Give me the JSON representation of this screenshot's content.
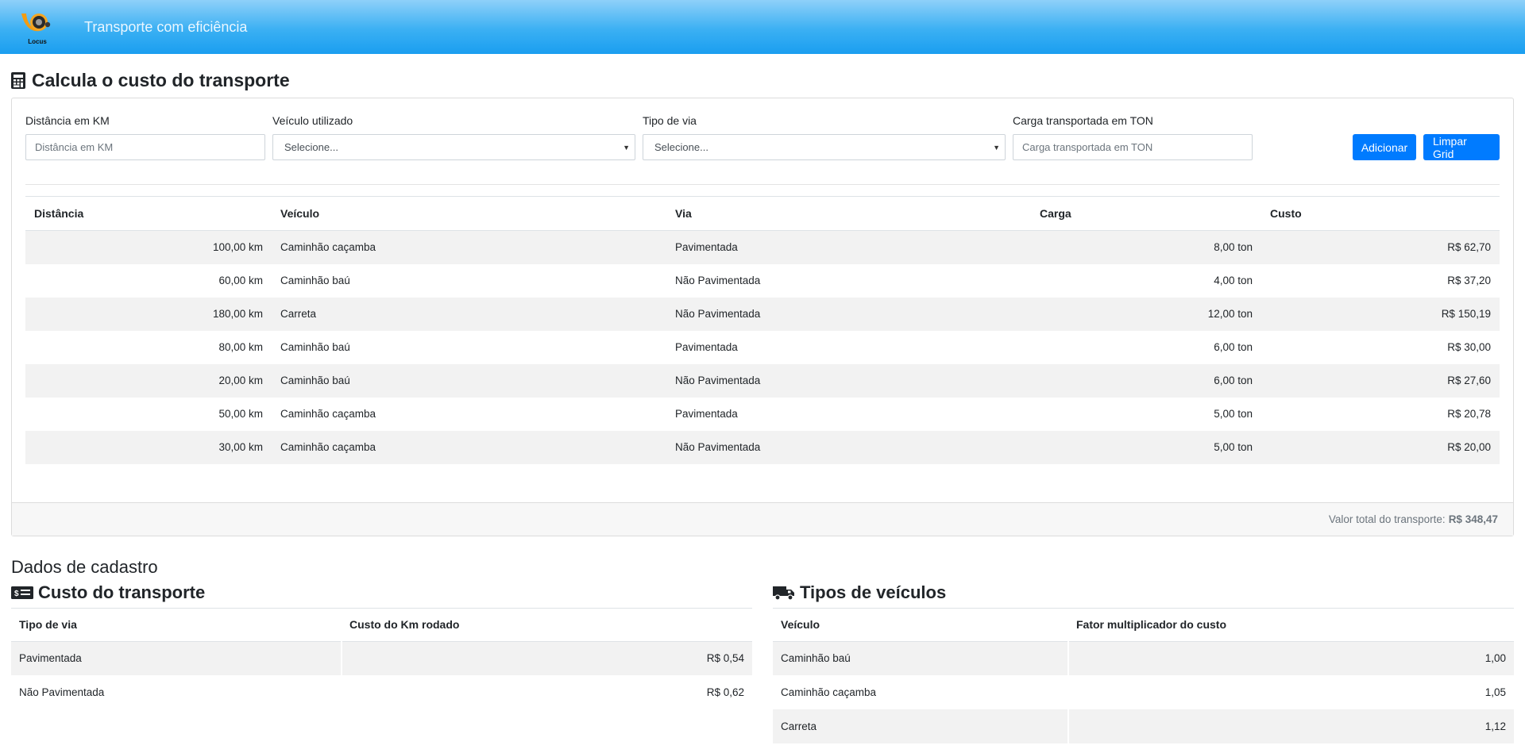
{
  "header": {
    "brand": "Transporte com eficiência",
    "logo_text": "Locus"
  },
  "calc": {
    "title": "Calcula o custo do transporte",
    "distance": {
      "label": "Distância em KM",
      "placeholder": "Distância em KM"
    },
    "vehicle": {
      "label": "Veículo utilizado",
      "selected": "Selecione..."
    },
    "road": {
      "label": "Tipo de via",
      "selected": "Selecione..."
    },
    "load": {
      "label": "Carga transportada em TON",
      "placeholder": "Carga transportada em TON"
    },
    "add_label": "Adicionar",
    "clear_label": "Limpar Grid",
    "columns": [
      "Distância",
      "Veículo",
      "Via",
      "Carga",
      "Custo"
    ],
    "rows": [
      {
        "distance": "100,00 km",
        "vehicle": "Caminhão caçamba",
        "road": "Pavimentada",
        "load": "8,00 ton",
        "cost": "R$ 62,70"
      },
      {
        "distance": "60,00 km",
        "vehicle": "Caminhão baú",
        "road": "Não Pavimentada",
        "load": "4,00 ton",
        "cost": "R$ 37,20"
      },
      {
        "distance": "180,00 km",
        "vehicle": "Carreta",
        "road": "Não Pavimentada",
        "load": "12,00 ton",
        "cost": "R$ 150,19"
      },
      {
        "distance": "80,00 km",
        "vehicle": "Caminhão baú",
        "road": "Pavimentada",
        "load": "6,00 ton",
        "cost": "R$ 30,00"
      },
      {
        "distance": "20,00 km",
        "vehicle": "Caminhão baú",
        "road": "Não Pavimentada",
        "load": "6,00 ton",
        "cost": "R$ 27,60"
      },
      {
        "distance": "50,00 km",
        "vehicle": "Caminhão caçamba",
        "road": "Pavimentada",
        "load": "5,00 ton",
        "cost": "R$ 20,78"
      },
      {
        "distance": "30,00 km",
        "vehicle": "Caminhão caçamba",
        "road": "Não Pavimentada",
        "load": "5,00 ton",
        "cost": "R$ 20,00"
      }
    ],
    "total_label": "Valor total do transporte:",
    "total_value": "R$ 348,47"
  },
  "registry": {
    "title": "Dados de cadastro",
    "cost": {
      "title": "Custo do transporte",
      "columns": [
        "Tipo de via",
        "Custo do Km rodado"
      ],
      "rows": [
        {
          "name": "Pavimentada",
          "value": "R$ 0,54"
        },
        {
          "name": "Não Pavimentada",
          "value": "R$ 0,62"
        }
      ]
    },
    "vehicles": {
      "title": "Tipos de veículos",
      "columns": [
        "Veículo",
        "Fator multiplicador do custo"
      ],
      "rows": [
        {
          "name": "Caminhão baú",
          "value": "1,00"
        },
        {
          "name": "Caminhão caçamba",
          "value": "1,05"
        },
        {
          "name": "Carreta",
          "value": "1,12"
        }
      ]
    }
  },
  "colors": {
    "accent": "#007bff",
    "header_top": "#8ed0f9",
    "header_bottom": "#1a9ef0"
  }
}
